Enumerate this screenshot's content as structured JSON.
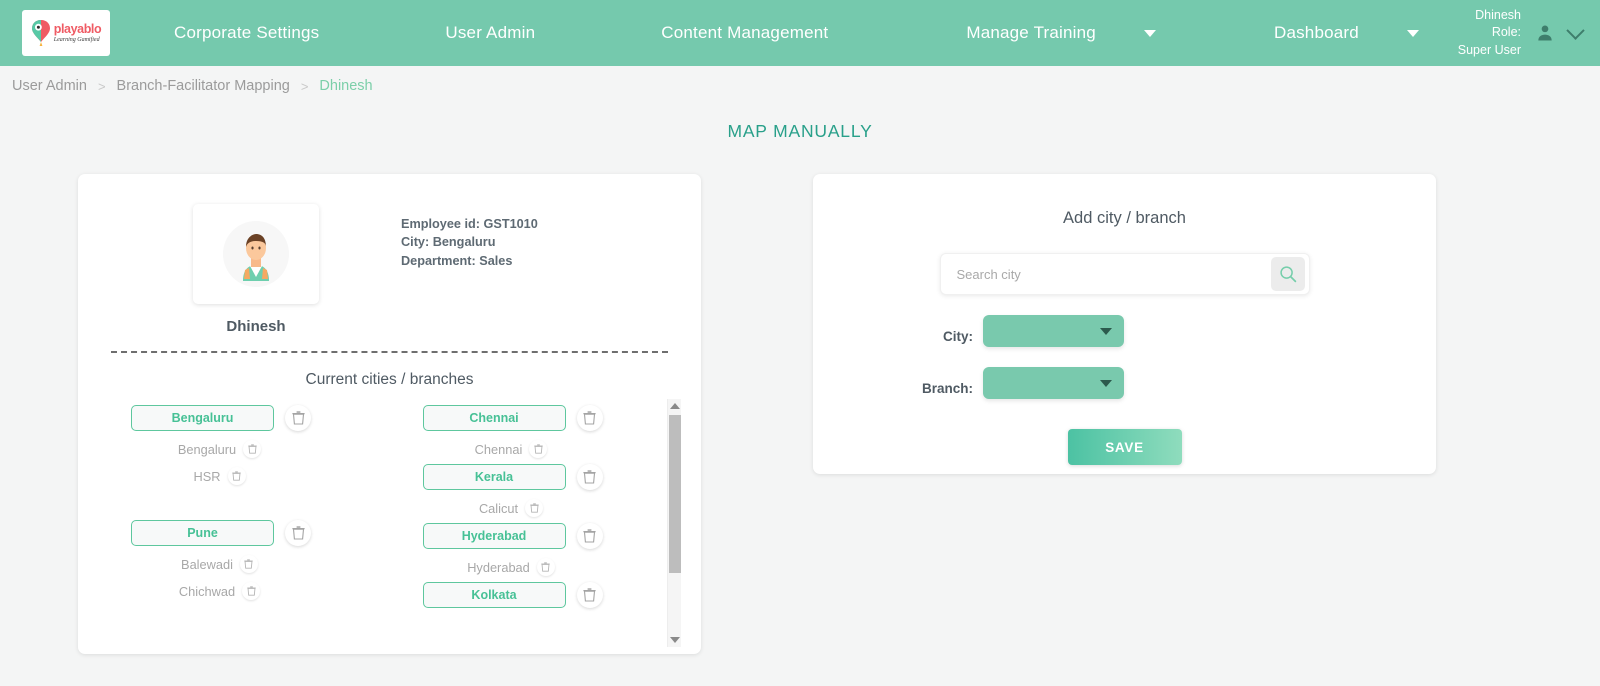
{
  "brand": {
    "logo_word": "playablo",
    "logo_tagline": "Learning Gamified",
    "accent_green": "#75c9ad",
    "accent_teal": "#29a08a",
    "pill_green": "#47c196"
  },
  "navbar": {
    "items": [
      {
        "label": "Corporate Settings",
        "has_caret": false
      },
      {
        "label": "User Admin",
        "has_caret": false
      },
      {
        "label": "Content Management",
        "has_caret": false
      },
      {
        "label": "Manage Training",
        "has_caret": true
      },
      {
        "label": "Dashboard",
        "has_caret": true
      }
    ],
    "user": {
      "name": "Dhinesh",
      "role_label": "Role:",
      "role_value": "Super User"
    }
  },
  "breadcrumb": {
    "items": [
      {
        "label": "User Admin",
        "active": false
      },
      {
        "label": "Branch-Facilitator Mapping",
        "active": false
      },
      {
        "label": "Dhinesh",
        "active": true
      }
    ],
    "separator": ">"
  },
  "page": {
    "title": "MAP MANUALLY"
  },
  "profile": {
    "name": "Dhinesh",
    "employee_id_line": "Employee id: GST1010",
    "city_line": "City: Bengaluru",
    "department_line": "Department: Sales"
  },
  "current_section": {
    "title": "Current cities / branches",
    "columns": [
      {
        "entries": [
          {
            "city": "Bengaluru",
            "branches": [
              "Bengaluru",
              "HSR"
            ]
          },
          {
            "city": "Pune",
            "branches": [
              "Balewadi",
              "Chichwad"
            ]
          }
        ]
      },
      {
        "entries": [
          {
            "city": "Chennai",
            "branches": [
              "Chennai"
            ]
          },
          {
            "city": "Kerala",
            "branches": [
              "Calicut"
            ]
          },
          {
            "city": "Hyderabad",
            "branches": [
              "Hyderabad"
            ]
          },
          {
            "city": "Kolkata",
            "branches": []
          }
        ]
      }
    ]
  },
  "add_panel": {
    "title": "Add city / branch",
    "search_placeholder": "Search city",
    "search_value": "",
    "city_label": "City:",
    "city_value": "",
    "branch_label": "Branch:",
    "branch_value": "",
    "save_label": "SAVE"
  }
}
